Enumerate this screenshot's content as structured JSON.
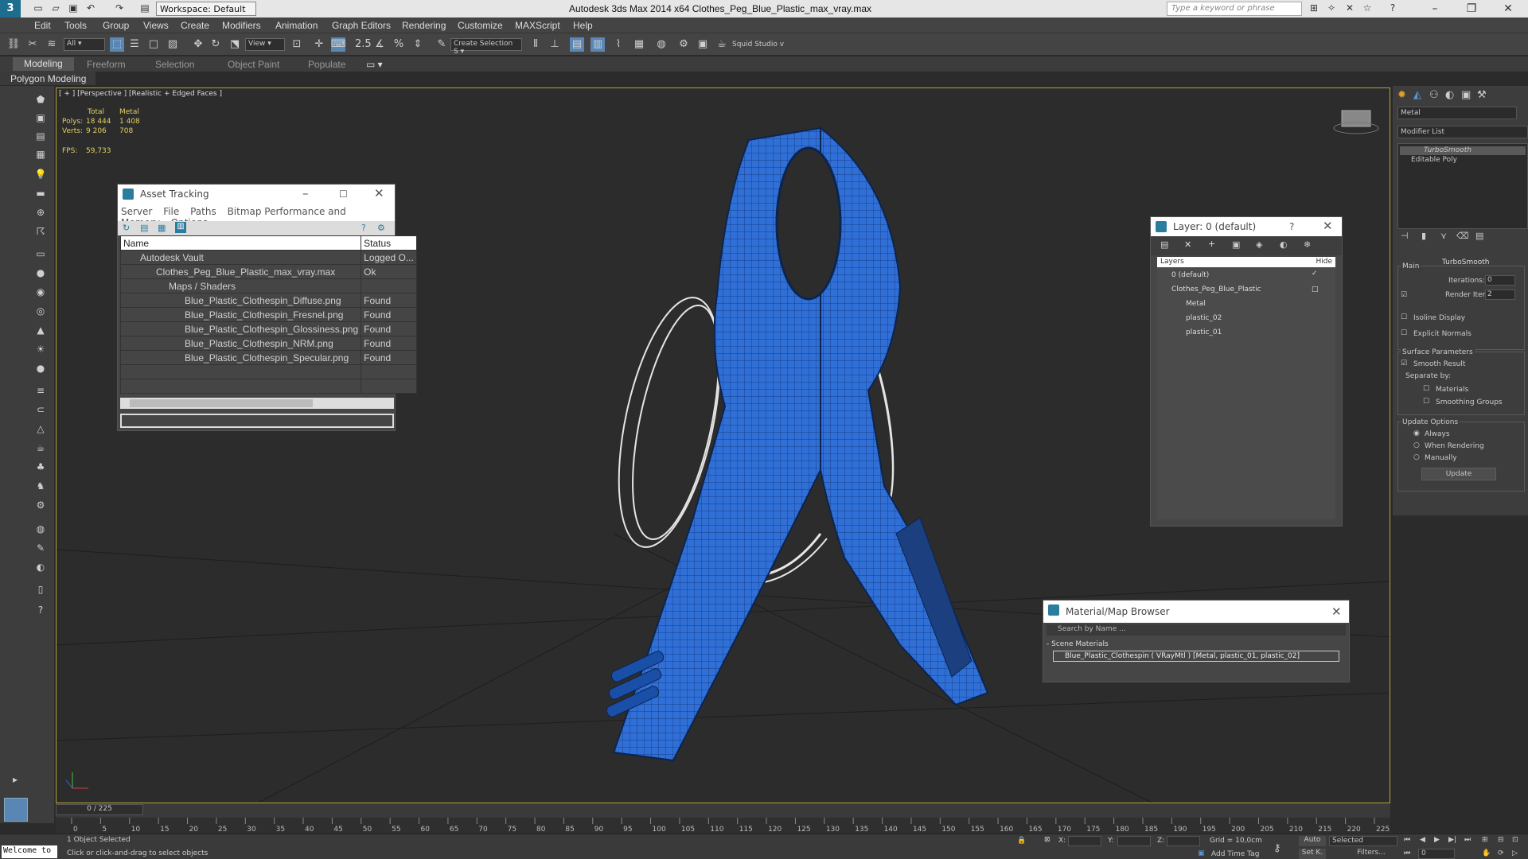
{
  "app_title": "Autodesk 3ds Max  2014 x64     Clothes_Peg_Blue_Plastic_max_vray.max",
  "workspace": "Workspace: Default",
  "search_placeholder": "Type a keyword or phrase",
  "menu": [
    "Edit",
    "Tools",
    "Group",
    "Views",
    "Create",
    "Modifiers",
    "Animation",
    "Graph Editors",
    "Rendering",
    "Customize",
    "MAXScript",
    "Help"
  ],
  "toolbar": {
    "selection_filter": "All",
    "ref_coord": "View",
    "named_selection": "Create Selection S",
    "studio": "Squid Studio v"
  },
  "ribbon": {
    "tabs": [
      "Modeling",
      "Freeform",
      "Selection",
      "Object Paint",
      "Populate"
    ],
    "sub": "Polygon Modeling"
  },
  "viewport": {
    "label": "[ + ] [Perspective ] [Realistic + Edged Faces ]",
    "stats_headers": [
      "Total",
      "Metal"
    ],
    "polys_label": "Polys:",
    "polys_total": "18 444",
    "polys_metal": "1 408",
    "verts_label": "Verts:",
    "verts_total": "9 206",
    "verts_metal": "708",
    "fps_label": "FPS:",
    "fps": "59,733"
  },
  "asset_tracking": {
    "title": "Asset Tracking",
    "menu": [
      "Server",
      "File",
      "Paths",
      "Bitmap Performance and Memory",
      "Options"
    ],
    "col_name": "Name",
    "col_status": "Status",
    "rows": [
      {
        "name": "Autodesk Vault",
        "status": "Logged O..."
      },
      {
        "name": "Clothes_Peg_Blue_Plastic_max_vray.max",
        "status": "Ok"
      },
      {
        "name": "Maps / Shaders",
        "status": ""
      },
      {
        "name": "Blue_Plastic_Clothespin_Diffuse.png",
        "status": "Found"
      },
      {
        "name": "Blue_Plastic_Clothespin_Fresnel.png",
        "status": "Found"
      },
      {
        "name": "Blue_Plastic_Clothespin_Glossiness.png",
        "status": "Found"
      },
      {
        "name": "Blue_Plastic_Clothespin_NRM.png",
        "status": "Found"
      },
      {
        "name": "Blue_Plastic_Clothespin_Specular.png",
        "status": "Found"
      }
    ]
  },
  "layer_window": {
    "title": "Layer: 0 (default)",
    "col_layers": "Layers",
    "col_hide": "Hide",
    "rows": [
      "0 (default)",
      "Clothes_Peg_Blue_Plastic",
      "Metal",
      "plastic_02",
      "plastic_01"
    ]
  },
  "material_browser": {
    "title": "Material/Map Browser",
    "search": "Search by Name ...",
    "section": "- Scene Materials",
    "item": "Blue_Plastic_Clothespin ( VRayMtl ) [Metal, plastic_01, plastic_02]"
  },
  "modifier_panel": {
    "name": "Metal",
    "modifier_list": "Modifier List",
    "stack": [
      "TurboSmooth",
      "Editable Poly"
    ],
    "rollout": "TurboSmooth",
    "main": "Main",
    "iterations_label": "Iterations:",
    "iterations": "0",
    "render_iters_label": "Render Iters:",
    "render_iters": "2",
    "isoline": "Isoline Display",
    "explicit": "Explicit Normals",
    "surface": "Surface Parameters",
    "smooth": "Smooth Result",
    "separate": "Separate by:",
    "materials": "Materials",
    "smoothing": "Smoothing Groups",
    "update_opts": "Update Options",
    "always": "Always",
    "when_rendering": "When Rendering",
    "manually": "Manually",
    "update_btn": "Update"
  },
  "timeline": {
    "frame": "0 / 225",
    "ticks": [
      "0",
      "5",
      "10",
      "15",
      "20",
      "25",
      "30",
      "35",
      "40",
      "45",
      "50",
      "55",
      "60",
      "65",
      "70",
      "75",
      "80",
      "85",
      "90",
      "95",
      "100",
      "105",
      "110",
      "115",
      "120",
      "125",
      "130",
      "135",
      "140",
      "145",
      "150",
      "155",
      "160",
      "165",
      "170",
      "175",
      "180",
      "185",
      "190",
      "195",
      "200",
      "205",
      "210",
      "215",
      "220",
      "225"
    ]
  },
  "status": {
    "welcome": "Welcome to",
    "selected": "1 Object Selected",
    "hint": "Click or click-and-drag to select objects",
    "x_label": "X:",
    "y_label": "Y:",
    "z_label": "Z:",
    "grid": "Grid = 10,0cm",
    "add_time_tag": "Add Time Tag",
    "auto": "Auto",
    "selected_dd": "Selected",
    "setk": "Set K.",
    "filters": "Filters...",
    "frame_field": "0"
  },
  "colors": {
    "model_blue": "#2f6fd6",
    "viewport_bg": "#2c2c2c",
    "viewport_border": "#b8a23a",
    "stat_yellow": "#e0d060"
  }
}
